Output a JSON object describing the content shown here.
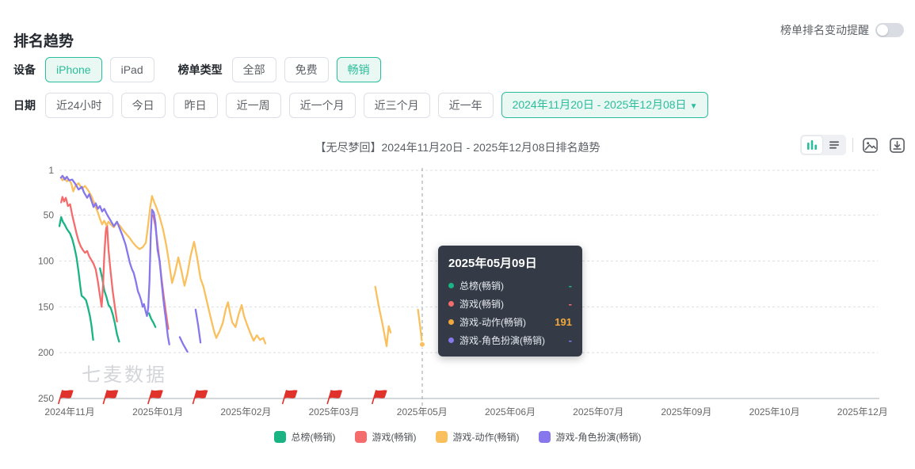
{
  "header": {
    "title": "排名趋势",
    "reminder_label": "榜单排名变动提醒",
    "reminder_on": false
  },
  "filters": {
    "device_label": "设备",
    "device_options": [
      {
        "label": "iPhone",
        "active": true
      },
      {
        "label": "iPad",
        "active": false
      }
    ],
    "list_type_label": "榜单类型",
    "list_type_options": [
      {
        "label": "全部",
        "active": false
      },
      {
        "label": "免费",
        "active": false
      },
      {
        "label": "畅销",
        "active": true
      }
    ],
    "date_label": "日期",
    "date_options": [
      {
        "label": "近24小时",
        "active": false
      },
      {
        "label": "今日",
        "active": false
      },
      {
        "label": "昨日",
        "active": false
      },
      {
        "label": "近一周",
        "active": false
      },
      {
        "label": "近一个月",
        "active": false
      },
      {
        "label": "近三个月",
        "active": false
      },
      {
        "label": "近一年",
        "active": false
      }
    ],
    "date_range": {
      "label": "2024年11月20日 - 2025年12月08日",
      "active": true,
      "caret": "▼"
    }
  },
  "chart_header": {
    "title": "【无尽梦回】2024年11月20日 - 2025年12月08日排名趋势"
  },
  "tooltip": {
    "date": "2025年05月09日",
    "rows": [
      {
        "name": "总榜(畅销)",
        "value": "-",
        "color": "#1ab384"
      },
      {
        "name": "游戏(畅销)",
        "value": "-",
        "color": "#f56c6c"
      },
      {
        "name": "游戏-动作(畅销)",
        "value": "191",
        "color": "#f3a83c"
      },
      {
        "name": "游戏-角色扮演(畅销)",
        "value": "-",
        "color": "#8678ec"
      }
    ]
  },
  "watermark": "七麦数据",
  "legend": [
    {
      "name": "总榜(畅销)",
      "color": "#1ab384"
    },
    {
      "name": "游戏(畅销)",
      "color": "#f56c6c"
    },
    {
      "name": "游戏-动作(畅销)",
      "color": "#fac05d"
    },
    {
      "name": "游戏-角色扮演(畅销)",
      "color": "#8678ec"
    }
  ],
  "chart_data": {
    "type": "line",
    "title": "【无尽梦回】2024年11月20日 - 2025年12月08日排名趋势",
    "y_axis": {
      "inverted": true,
      "range": [
        1,
        250
      ],
      "ticks": [
        1,
        50,
        100,
        150,
        200,
        250
      ]
    },
    "x_axis": {
      "start_date": "2024-11-20",
      "end_date": "2025-12-08",
      "tick_labels": [
        "2024年11月",
        "2025年01月",
        "2025年02月",
        "2025年03月",
        "2025年05月",
        "2025年06月",
        "2025年07月",
        "2025年09月",
        "2025年10月",
        "2025年12月"
      ]
    },
    "crosshair_day": 170,
    "highlight_point": {
      "day": 170,
      "rank": 191,
      "series": "游戏-动作(畅销)"
    },
    "flags_days": [
      1,
      22,
      43,
      64,
      106,
      127,
      148
    ],
    "series": [
      {
        "name": "总榜(畅销)",
        "color": "#1ab384",
        "segments": [
          [
            [
              0,
              62
            ],
            [
              0.8,
              52
            ],
            [
              1.6,
              57
            ],
            [
              2.4,
              60
            ],
            [
              3.5,
              65
            ],
            [
              5,
              70
            ],
            [
              6,
              76
            ],
            [
              7,
              85
            ],
            [
              8,
              96
            ],
            [
              9,
              112
            ],
            [
              9.8,
              128
            ],
            [
              10.4,
              138
            ],
            [
              11.5,
              140
            ],
            [
              12.5,
              143
            ],
            [
              13.5,
              152
            ],
            [
              14.3,
              160
            ],
            [
              15,
              170
            ],
            [
              15.8,
              186
            ]
          ],
          [
            [
              19,
              108
            ],
            [
              20,
              118
            ],
            [
              21,
              132
            ],
            [
              22,
              139
            ],
            [
              23,
              148
            ],
            [
              24,
              151
            ],
            [
              25,
              158
            ],
            [
              26,
              168
            ],
            [
              27,
              180
            ],
            [
              28,
              188
            ]
          ],
          [
            [
              42,
              157
            ],
            [
              43,
              163
            ],
            [
              44,
              167
            ],
            [
              45,
              172
            ]
          ]
        ]
      },
      {
        "name": "游戏(畅销)",
        "color": "#f56c6c",
        "segments": [
          [
            [
              0.8,
              36
            ],
            [
              1.4,
              30
            ],
            [
              2.2,
              35
            ],
            [
              3,
              31
            ],
            [
              4,
              40
            ],
            [
              5,
              38
            ],
            [
              6,
              50
            ],
            [
              7,
              60
            ],
            [
              8,
              70
            ],
            [
              9,
              78
            ],
            [
              10,
              84
            ],
            [
              11,
              88
            ],
            [
              12,
              91
            ],
            [
              13,
              89
            ],
            [
              14,
              95
            ],
            [
              15,
              99
            ],
            [
              16,
              103
            ],
            [
              17,
              109
            ],
            [
              18,
              122
            ],
            [
              19,
              138
            ],
            [
              19.8,
              150
            ],
            [
              20.4,
              128
            ],
            [
              21,
              95
            ],
            [
              21.7,
              68
            ],
            [
              22.3,
              60
            ],
            [
              23,
              88
            ],
            [
              24,
              112
            ],
            [
              25,
              133
            ],
            [
              26,
              150
            ],
            [
              27,
              166
            ]
          ],
          [
            [
              44,
              50
            ],
            [
              45,
              62
            ],
            [
              46,
              82
            ],
            [
              47,
              102
            ],
            [
              48,
              122
            ],
            [
              49,
              141
            ],
            [
              50,
              158
            ],
            [
              51,
              174
            ]
          ]
        ]
      },
      {
        "name": "游戏-动作(畅销)",
        "color": "#fac05d",
        "segments": [
          [
            [
              0.7,
              9
            ],
            [
              1.5,
              12
            ],
            [
              2.5,
              9
            ],
            [
              3.5,
              13
            ],
            [
              4.5,
              11
            ],
            [
              5.5,
              15
            ],
            [
              6.5,
              24
            ],
            [
              7.5,
              18
            ],
            [
              9,
              15
            ],
            [
              10.5,
              21
            ],
            [
              12,
              18
            ],
            [
              13.5,
              23
            ],
            [
              15,
              29
            ],
            [
              16,
              35
            ],
            [
              17,
              41
            ],
            [
              18,
              47
            ],
            [
              19,
              54
            ],
            [
              20,
              60
            ],
            [
              21,
              56
            ],
            [
              22,
              61
            ],
            [
              23,
              57
            ],
            [
              24,
              60
            ],
            [
              25.5,
              63
            ],
            [
              27,
              58
            ],
            [
              28.5,
              62
            ],
            [
              30,
              67
            ],
            [
              31.5,
              71
            ],
            [
              33,
              75
            ],
            [
              34.5,
              80
            ],
            [
              36,
              84
            ],
            [
              37.5,
              87
            ],
            [
              39,
              85
            ],
            [
              40.5,
              80
            ],
            [
              41.5,
              62
            ],
            [
              42.5,
              42
            ],
            [
              43.4,
              29
            ],
            [
              44.3,
              35
            ],
            [
              45.5,
              42
            ],
            [
              47,
              52
            ],
            [
              48.5,
              65
            ],
            [
              50,
              82
            ],
            [
              51,
              96
            ],
            [
              52,
              112
            ],
            [
              52.8,
              124
            ],
            [
              54,
              114
            ],
            [
              55.7,
              96
            ],
            [
              57,
              109
            ],
            [
              58.6,
              127
            ],
            [
              60,
              114
            ],
            [
              61.5,
              94
            ],
            [
              63.1,
              79
            ],
            [
              64.5,
              96
            ],
            [
              66.1,
              119
            ],
            [
              67.5,
              128
            ],
            [
              69,
              143
            ],
            [
              70.5,
              158
            ],
            [
              72.4,
              176
            ],
            [
              73.5,
              184
            ],
            [
              75,
              177
            ],
            [
              76.5,
              168
            ],
            [
              78,
              152
            ],
            [
              79,
              145
            ],
            [
              80,
              157
            ],
            [
              81,
              167
            ],
            [
              82.5,
              172
            ],
            [
              84,
              158
            ],
            [
              85.4,
              148
            ],
            [
              86.5,
              160
            ],
            [
              88,
              170
            ],
            [
              89.5,
              179
            ],
            [
              91,
              187
            ],
            [
              92.5,
              181
            ],
            [
              94,
              186
            ],
            [
              95.5,
              184
            ],
            [
              96.5,
              190
            ]
          ],
          [
            [
              148,
              128
            ],
            [
              149.5,
              148
            ],
            [
              151.5,
              170
            ],
            [
              153.3,
              193
            ],
            [
              154.3,
              171
            ],
            [
              155.2,
              178
            ]
          ],
          [
            [
              168,
              153
            ],
            [
              169,
              171
            ],
            [
              170,
              191
            ]
          ]
        ]
      },
      {
        "name": "游戏-角色扮演(畅销)",
        "color": "#8678ec",
        "segments": [
          [
            [
              0.7,
              9
            ],
            [
              1.5,
              7
            ],
            [
              2.5,
              11
            ],
            [
              3.5,
              8
            ],
            [
              4.5,
              12
            ],
            [
              6,
              11
            ],
            [
              7.5,
              16
            ],
            [
              9,
              22
            ],
            [
              10.5,
              19
            ],
            [
              11.5,
              25
            ],
            [
              13,
              31
            ],
            [
              14,
              27
            ],
            [
              15,
              34
            ],
            [
              16,
              41
            ],
            [
              17,
              37
            ],
            [
              18,
              43
            ],
            [
              19,
              40
            ],
            [
              20,
              46
            ],
            [
              21,
              43
            ],
            [
              22.5,
              50
            ],
            [
              24,
              56
            ],
            [
              25.5,
              62
            ],
            [
              27,
              57
            ],
            [
              28,
              63
            ],
            [
              29.5,
              72
            ],
            [
              31,
              82
            ],
            [
              32,
              92
            ],
            [
              33,
              102
            ],
            [
              34,
              109
            ],
            [
              34.8,
              113
            ],
            [
              35.8,
              122
            ],
            [
              36.8,
              133
            ],
            [
              37.5,
              137
            ],
            [
              38.3,
              143
            ],
            [
              39,
              150
            ],
            [
              39.6,
              147
            ],
            [
              40.3,
              154
            ],
            [
              41,
              160
            ],
            [
              41.6,
              151
            ],
            [
              42.2,
              122
            ],
            [
              42.8,
              72
            ],
            [
              43.4,
              44
            ],
            [
              44.2,
              47
            ],
            [
              45,
              58
            ],
            [
              46,
              88
            ],
            [
              47,
              100
            ],
            [
              48,
              126
            ],
            [
              49,
              148
            ],
            [
              50,
              166
            ],
            [
              50.8,
              182
            ],
            [
              51.5,
              191
            ]
          ],
          [
            [
              56.4,
              183
            ],
            [
              58,
              191
            ],
            [
              60,
              199
            ]
          ],
          [
            [
              63.8,
              153
            ],
            [
              65,
              170
            ],
            [
              66.1,
              189
            ]
          ]
        ]
      }
    ]
  }
}
